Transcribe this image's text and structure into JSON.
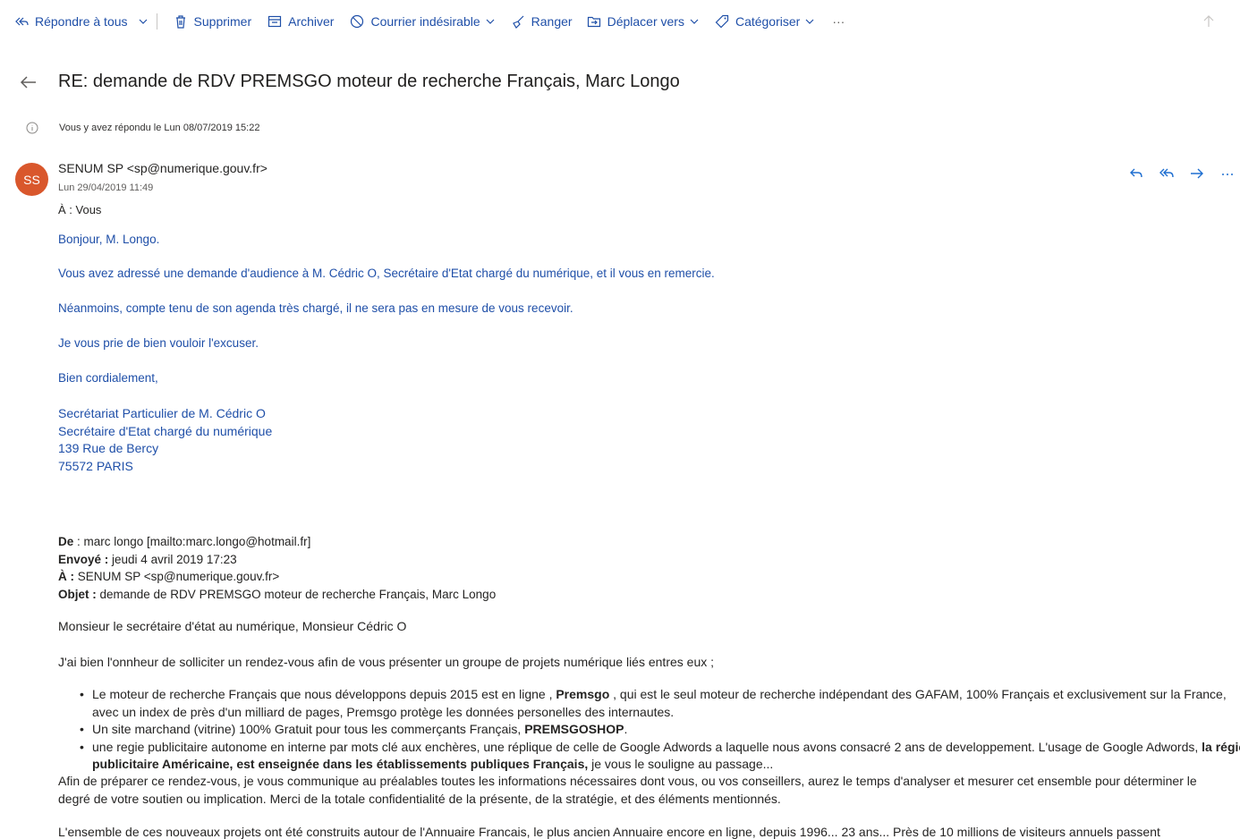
{
  "toolbar": {
    "reply_all": "Répondre à tous",
    "delete": "Supprimer",
    "archive": "Archiver",
    "junk": "Courrier indésirable",
    "sweep": "Ranger",
    "move_to": "Déplacer vers",
    "categorize": "Catégoriser",
    "more": "···"
  },
  "message": {
    "subject": "RE: demande de RDV PREMSGO moteur de recherche Français, Marc Longo",
    "info": "Vous y avez répondu le Lun 08/07/2019 15:22",
    "avatar_initials": "SS",
    "sender": "SENUM SP <sp@numerique.gouv.fr>",
    "date": "Lun 29/04/2019 11:49",
    "to": "À : Vous"
  },
  "reply": {
    "greeting": "Bonjour, M. Longo.",
    "p1": "Vous avez adressé une demande d'audience à M. Cédric O, Secrétaire d'Etat chargé du numérique, et il vous en remercie.",
    "p2": "Néanmoins, compte tenu de son agenda très chargé, il ne sera pas en mesure de vous recevoir.",
    "p3": "Je vous prie de bien vouloir l'excuser.",
    "closing": "Bien cordialement,",
    "sig1": "Secrétariat Particulier de M. Cédric O",
    "sig2": "Secrétaire d'Etat chargé du numérique",
    "sig3": "139 Rue de Bercy",
    "sig4": "75572 PARIS"
  },
  "original": {
    "from_label": "De",
    "from": " : marc longo [mailto:marc.longo@hotmail.fr]",
    "sent_label": "Envoyé :",
    "sent": " jeudi 4 avril 2019 17:23",
    "to_label": "À :",
    "to": " SENUM SP <sp@numerique.gouv.fr>",
    "subject_label": "Objet :",
    "subject": " demande de RDV PREMSGO moteur de recherche Français, Marc Longo",
    "salutation": "Monsieur le secrétaire d'état au numérique, Monsieur Cédric O",
    "intro": "J'ai bien l'onnheur de solliciter un rendez-vous afin de vous présenter un groupe de projets numérique liés  entres eux ;",
    "b1_a": "Le moteur de recherche Français que nous développons depuis 2015 est en ligne , ",
    "b1_bold": "Premsgo",
    "b1_b": " , qui est le seul moteur de recherche indépendant des GAFAM, 100% Français et exclusivement sur la France, avec un index de près d'un milliard de pages, Premsgo protège les données personelles des internautes.",
    "b2_a": "Un site marchand (vitrine) 100% Gratuit pour tous les commerçants Français, ",
    "b2_bold": "PREMSGOSHOP",
    "b2_b": ".",
    "b3_a": "une regie publicitaire autonome en interne par mots clé aux enchères, une réplique de celle de Google Adwords a laquelle nous avons consacré 2 ans de developpement. L'usage de Google Adwords, ",
    "b3_bold": "la régie publicitaire Américaine, est enseignée dans les établissements publiques Français,",
    "b3_b": " je vous le souligne au passage...",
    "tail": "Afin de préparer ce rendez-vous, je vous communique au préalables toutes les informations nécessaires dont vous, ou vos conseillers, aurez le temps d'analyser et mesurer cet ensemble pour déterminer le degré de votre soutien ou implication. Merci de la totale confidentialité de la présente, de la stratégie, et des éléments mentionnés.",
    "cut": "L'ensemble de ces nouveaux projets ont été construits autour de l'Annuaire Francais, le plus ancien Annuaire encore en ligne, depuis 1996... 23 ans... Près de 10 millions de visiteurs annuels passent"
  }
}
